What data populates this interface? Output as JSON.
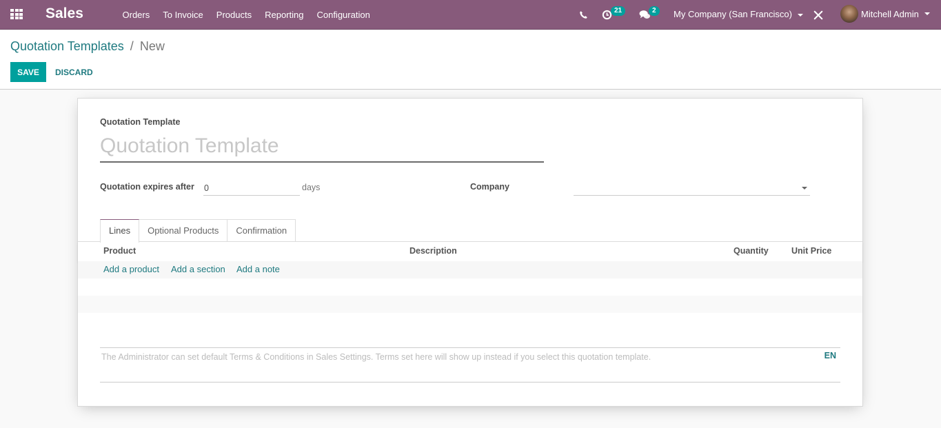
{
  "navbar": {
    "app_name": "Sales",
    "menu": [
      "Orders",
      "To Invoice",
      "Products",
      "Reporting",
      "Configuration"
    ],
    "activity_count": "21",
    "message_count": "2",
    "company": "My Company (San Francisco)",
    "user": "Mitchell Admin",
    "icons": [
      "apps-grid-icon",
      "phone-icon",
      "clock-activity-icon",
      "chat-bubbles-icon",
      "debug-tools-icon",
      "avatar"
    ],
    "color": "#875a7b"
  },
  "control_panel": {
    "breadcrumb_parent": "Quotation Templates",
    "breadcrumb_separator": "/",
    "breadcrumb_current": "New",
    "save_label": "SAVE",
    "discard_label": "DISCARD"
  },
  "form": {
    "name_label": "Quotation Template",
    "name_placeholder": "Quotation Template",
    "name_value": "",
    "expires_label": "Quotation expires after",
    "expires_value": "0",
    "expires_unit": "days",
    "company_label": "Company",
    "company_value": ""
  },
  "tabs": [
    {
      "label": "Lines",
      "active": true
    },
    {
      "label": "Optional Products",
      "active": false
    },
    {
      "label": "Confirmation",
      "active": false
    }
  ],
  "lines_table": {
    "columns": [
      "Product",
      "Description",
      "Quantity",
      "Unit Price"
    ],
    "actions": [
      "Add a product",
      "Add a section",
      "Add a note"
    ],
    "rows": []
  },
  "notes": {
    "placeholder": "The Administrator can set default Terms & Conditions in Sales Settings. Terms set here will show up instead if you select this quotation template.",
    "lang": "EN"
  },
  "colors": {
    "primary": "#00a09d",
    "link": "#1f7a80",
    "brand": "#875a7b"
  }
}
